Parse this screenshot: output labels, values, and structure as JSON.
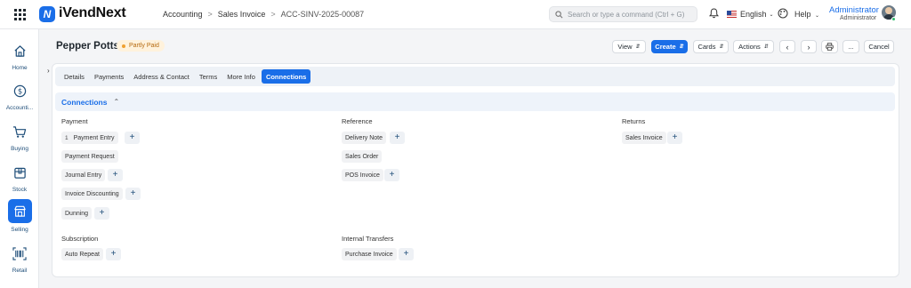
{
  "app": {
    "brand": "iVendNext",
    "search_placeholder": "Search or type a command (Ctrl + G)",
    "language": "English",
    "help": "Help",
    "user_name": "Administrator",
    "user_role": "Administrator"
  },
  "breadcrumb": [
    "Accounting",
    "Sales Invoice",
    "ACC-SINV-2025-00087"
  ],
  "sidebar": [
    {
      "label": "Home",
      "icon": "home-icon"
    },
    {
      "label": "Accounti...",
      "icon": "dollar-icon"
    },
    {
      "label": "Buying",
      "icon": "cart-icon"
    },
    {
      "label": "Stock",
      "icon": "box-icon"
    },
    {
      "label": "Selling",
      "icon": "selling-icon",
      "active": true
    },
    {
      "label": "Retail",
      "icon": "barcode-icon"
    }
  ],
  "page": {
    "title": "Pepper Potts",
    "status": "Partly Paid"
  },
  "toolbar": {
    "view": "View",
    "create": "Create",
    "cards": "Cards",
    "actions": "Actions",
    "more": "...",
    "cancel": "Cancel"
  },
  "tabs": [
    "Details",
    "Payments",
    "Address & Contact",
    "Terms",
    "More Info",
    "Connections"
  ],
  "connections": {
    "title": "Connections",
    "payment": {
      "label": "Payment",
      "items": [
        "Payment Entry",
        "Payment Request",
        "Journal Entry",
        "Invoice Discounting",
        "Dunning"
      ],
      "payment_entry_count": "1"
    },
    "reference": {
      "label": "Reference",
      "items": [
        "Delivery Note",
        "Sales Order",
        "POS Invoice"
      ]
    },
    "returns": {
      "label": "Returns",
      "items": [
        "Sales Invoice"
      ]
    },
    "subscription": {
      "label": "Subscription",
      "items": [
        "Auto Repeat"
      ]
    },
    "internal_transfers": {
      "label": "Internal Transfers",
      "items": [
        "Purchase Invoice"
      ]
    }
  },
  "colors": {
    "accent": "#1a6ee8",
    "status_bg": "#fff2dc",
    "status_fg": "#b56a10"
  }
}
